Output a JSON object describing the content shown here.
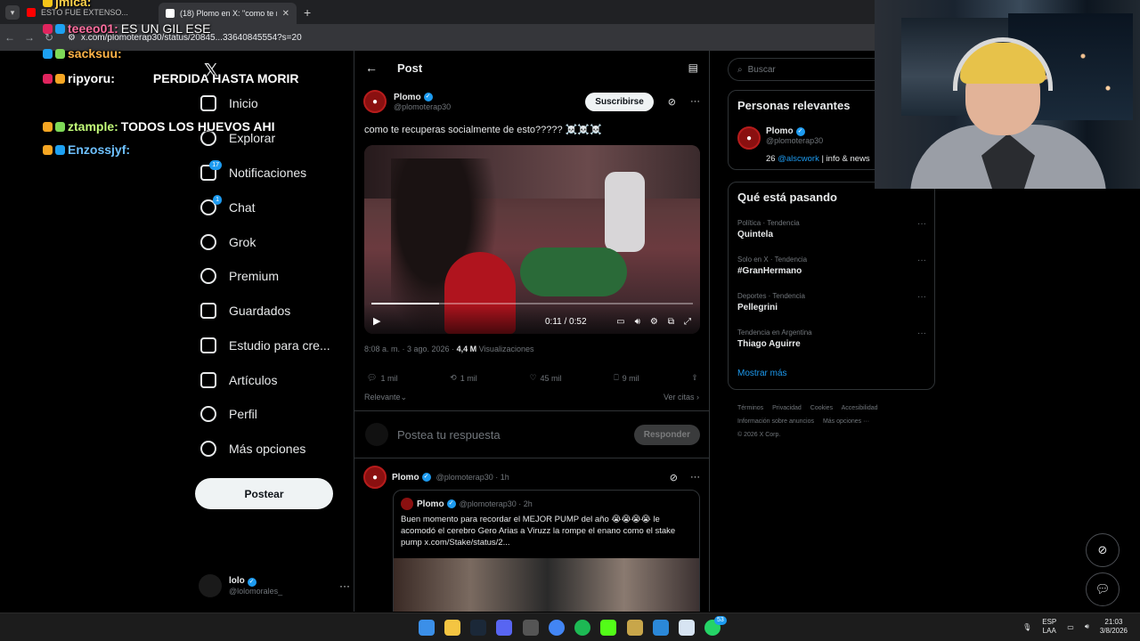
{
  "browser": {
    "tabs": [
      {
        "title": "ESTO FUE EXTENSO..."
      },
      {
        "title": "(18) Plomo en X: \"como te recu..."
      }
    ],
    "url": "x.com/plomoterap30/status/20845...33640845554?s=20"
  },
  "chat": [
    {
      "user": "jmica:",
      "msg": ""
    },
    {
      "user": "teeeo01:",
      "msg": "ES UN GIL ESE"
    },
    {
      "user": "sacksuu:",
      "msg": ""
    },
    {
      "user": "ripyoru:",
      "msg": "PERDIDA HASTA MORIR"
    },
    {
      "user": "ztample:",
      "msg": "TODOS LOS HUEVOS AHI"
    },
    {
      "user": "Enzossjyf:",
      "msg": ""
    }
  ],
  "nav": {
    "items": [
      {
        "label": "Inicio",
        "badge": ""
      },
      {
        "label": "Explorar",
        "badge": ""
      },
      {
        "label": "Notificaciones",
        "badge": "17"
      },
      {
        "label": "Chat",
        "badge": "1"
      },
      {
        "label": "Grok",
        "badge": ""
      },
      {
        "label": "Premium",
        "badge": ""
      },
      {
        "label": "Guardados",
        "badge": ""
      },
      {
        "label": "Estudio para cre...",
        "badge": ""
      },
      {
        "label": "Artículos",
        "badge": ""
      },
      {
        "label": "Perfil",
        "badge": ""
      },
      {
        "label": "Más opciones",
        "badge": ""
      }
    ],
    "post_button": "Postear",
    "account": {
      "name": "lolo",
      "handle": "@lolomorales_"
    }
  },
  "post": {
    "header_title": "Post",
    "author_name": "Plomo",
    "author_handle": "@plomoterap30",
    "subscribe_label": "Suscribirse",
    "text": "como te recuperas socialmente de esto????? ☠️☠️☠️",
    "video": {
      "time": "0:11 / 0:52",
      "progress": 0.21
    },
    "timestamp": "8:08 a. m. · 3 ago. 2026 · ",
    "views": "4,4 M",
    "views_label": "Visualizaciones",
    "actions": {
      "replies": "1 mil",
      "reposts": "1 mil",
      "likes": "45 mil",
      "bookmarks": "9 mil"
    },
    "sort_label": "Relevante",
    "quotes_label": "Ver citas"
  },
  "reply_box": {
    "placeholder": "Postea tu respuesta",
    "button": "Responder"
  },
  "reply": {
    "author_name": "Plomo",
    "author_handle": "@plomoterap30 · 1h",
    "quote": {
      "author_name": "Plomo",
      "author_handle": "@plomoterap30 · 2h",
      "text": "Buen momento para recordar el MEJOR PUMP del año 😭😭😭😭 le acomodó el cerebro Gero Arias a Viruzz la rompe el enano como el stake pump  x.com/Stake/status/2..."
    }
  },
  "sidebar": {
    "search_placeholder": "Buscar",
    "relevant_title": "Personas relevantes",
    "relevant_user": {
      "name": "Plomo",
      "handle": "@plomoterap30",
      "bio_prefix": "26 ",
      "bio_link": "@alscwork",
      "bio_suffix": " | info & news"
    },
    "trends_title": "Qué está pasando",
    "trends": [
      {
        "context": "Política · Tendencia",
        "name": "Quintela"
      },
      {
        "context": "Solo en X · Tendencia",
        "name": "#GranHermano"
      },
      {
        "context": "Deportes · Tendencia",
        "name": "Pellegrini"
      },
      {
        "context": "Tendencia en Argentina",
        "name": "Thiago Aguirre"
      }
    ],
    "show_more": "Mostrar más",
    "footer": [
      "Términos",
      "Privacidad",
      "Cookies",
      "Accesibilidad",
      "Información sobre anuncios",
      "Más opciones ···",
      "© 2026 X Corp."
    ]
  },
  "taskbar": {
    "lang": "ESP",
    "region": "LAA",
    "time": "21:03",
    "date": "3/8/2026",
    "badge": "53"
  },
  "colors": {
    "accent": "#1d9bf0",
    "background": "#000000",
    "border": "#2f3336",
    "muted": "#71767b"
  }
}
